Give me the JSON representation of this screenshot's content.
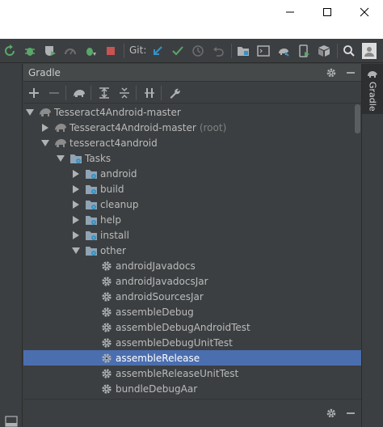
{
  "window": {
    "buttons": [
      "minimize",
      "maximize",
      "close"
    ]
  },
  "toolbar": {
    "git_label": "Git:"
  },
  "panel": {
    "title": "Gradle"
  },
  "right_strip": {
    "tab_label": "Gradle"
  },
  "tree": [
    {
      "label": "Tesseract4Android-master",
      "level": 0,
      "expanded": true,
      "icon": "elephant-icon"
    },
    {
      "label": "Tesseract4Android-master",
      "suffix": "(root)",
      "level": 1,
      "expanded": false,
      "icon": "elephant-icon"
    },
    {
      "label": "tesseract4android",
      "level": 1,
      "expanded": true,
      "icon": "elephant-icon"
    },
    {
      "label": "Tasks",
      "level": 2,
      "expanded": true,
      "icon": "task-folder-icon"
    },
    {
      "label": "android",
      "level": 3,
      "expanded": false,
      "icon": "task-folder-icon"
    },
    {
      "label": "build",
      "level": 3,
      "expanded": false,
      "icon": "task-folder-icon"
    },
    {
      "label": "cleanup",
      "level": 3,
      "expanded": false,
      "icon": "task-folder-icon"
    },
    {
      "label": "help",
      "level": 3,
      "expanded": false,
      "icon": "task-folder-icon"
    },
    {
      "label": "install",
      "level": 3,
      "expanded": false,
      "icon": "task-folder-icon"
    },
    {
      "label": "other",
      "level": 3,
      "expanded": true,
      "icon": "task-folder-icon"
    },
    {
      "label": "androidJavadocs",
      "level": 4,
      "icon": "gear-icon"
    },
    {
      "label": "androidJavadocsJar",
      "level": 4,
      "icon": "gear-icon"
    },
    {
      "label": "androidSourcesJar",
      "level": 4,
      "icon": "gear-icon"
    },
    {
      "label": "assembleDebug",
      "level": 4,
      "icon": "gear-icon"
    },
    {
      "label": "assembleDebugAndroidTest",
      "level": 4,
      "icon": "gear-icon"
    },
    {
      "label": "assembleDebugUnitTest",
      "level": 4,
      "icon": "gear-icon"
    },
    {
      "label": "assembleRelease",
      "level": 4,
      "icon": "gear-icon",
      "selected": true
    },
    {
      "label": "assembleReleaseUnitTest",
      "level": 4,
      "icon": "gear-icon"
    },
    {
      "label": "bundleDebugAar",
      "level": 4,
      "icon": "gear-icon"
    }
  ]
}
